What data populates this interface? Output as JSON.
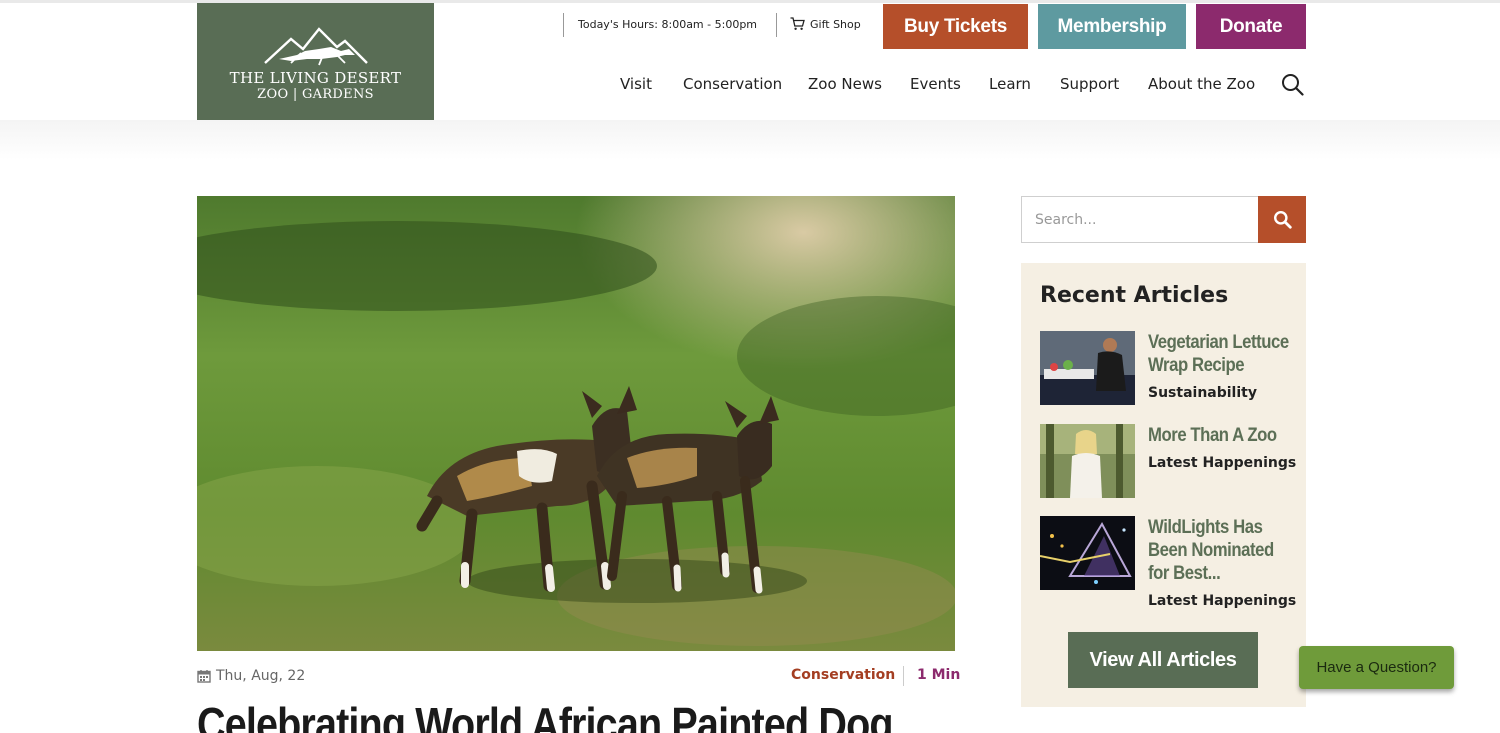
{
  "header": {
    "logo": {
      "line1": "THE LIVING DESERT",
      "line2": "ZOO | GARDENS"
    },
    "hours": "Today's Hours: 8:00am - 5:00pm",
    "gift_shop": "Gift Shop",
    "cta": {
      "buy": "Buy Tickets",
      "membership": "Membership",
      "donate": "Donate"
    },
    "nav": [
      "Visit",
      "Conservation",
      "Zoo News",
      "Events",
      "Learn",
      "Support",
      "About the Zoo"
    ]
  },
  "article": {
    "date": "Thu, Aug, 22",
    "category": "Conservation",
    "read_time": "1 Min",
    "title": "Celebrating World African Painted Dog"
  },
  "sidebar": {
    "search_placeholder": "Search...",
    "recent_title": "Recent Articles",
    "articles": [
      {
        "title": "Vegetarian Lettuce Wrap Recipe",
        "category": "Sustainability"
      },
      {
        "title": "More Than A Zoo",
        "category": "Latest Happenings"
      },
      {
        "title": "WildLights Has Been Nominated for Best...",
        "category": "Latest Happenings"
      }
    ],
    "view_all": "View All Articles"
  },
  "chat": {
    "label": "Have a Question?"
  },
  "colors": {
    "logo_bg": "#596d55",
    "buy": "#b54f2a",
    "membership": "#5e9aa0",
    "donate": "#8c2a6d",
    "sidebar_bg": "#f5efe3",
    "chat": "#6f9b3a"
  }
}
